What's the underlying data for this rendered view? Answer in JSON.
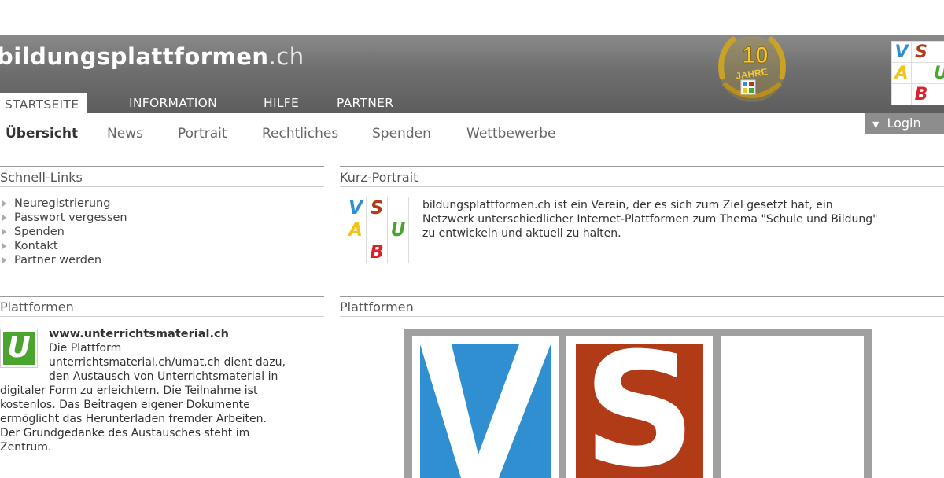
{
  "header": {
    "site_name": "bildungsplattformen",
    "site_tld": ".ch",
    "badge_number": "10",
    "badge_text": "JAHRE"
  },
  "logo": {
    "letters": [
      "V",
      "S",
      "A",
      "U",
      "B"
    ]
  },
  "main_nav": [
    "STARTSEITE",
    "INFORMATION",
    "HILFE",
    "PARTNER"
  ],
  "login_label": "Login",
  "sub_nav": [
    "Übersicht",
    "News",
    "Portrait",
    "Rechtliches",
    "Spenden",
    "Wettbewerbe"
  ],
  "schnell_links": {
    "title": "Schnell-Links",
    "items": [
      "Neuregistrierung",
      "Passwort vergessen",
      "Spenden",
      "Kontakt",
      "Partner werden"
    ]
  },
  "kurz_portrait": {
    "title": "Kurz-Portrait",
    "lines": [
      "bildungsplattformen.ch ist ein Verein, der es sich zum Ziel gesetzt hat, ein",
      "Netzwerk unterschiedlicher Internet-Plattformen zum Thema \"Schule und Bildung\"",
      "zu entwickeln und aktuell zu halten."
    ]
  },
  "plattformen_left": {
    "title": "Plattformen",
    "site": "www.unterrichtsmaterial.ch",
    "icon_letter": "U",
    "lines": [
      "Die Plattform",
      "unterrichtsmaterial.ch/umat.ch dient dazu,",
      "den Austausch von Unterrichtsmaterial in",
      "digitaler Form zu erleichtern. Die Teilnahme ist",
      "kostenlos. Das Beitragen eigener Dokumente",
      "ermöglicht das Herunterladen fremder Arbeiten.",
      "Der Grundgedanke des Austausches steht im",
      "Zentrum."
    ]
  },
  "plattformen_right": {
    "title": "Plattformen"
  },
  "colors": {
    "blue": "#2f8fd0",
    "red": "#b13a17",
    "yellow": "#f2c418",
    "green": "#4aa52e",
    "header_gray": "#6f6f6f"
  }
}
